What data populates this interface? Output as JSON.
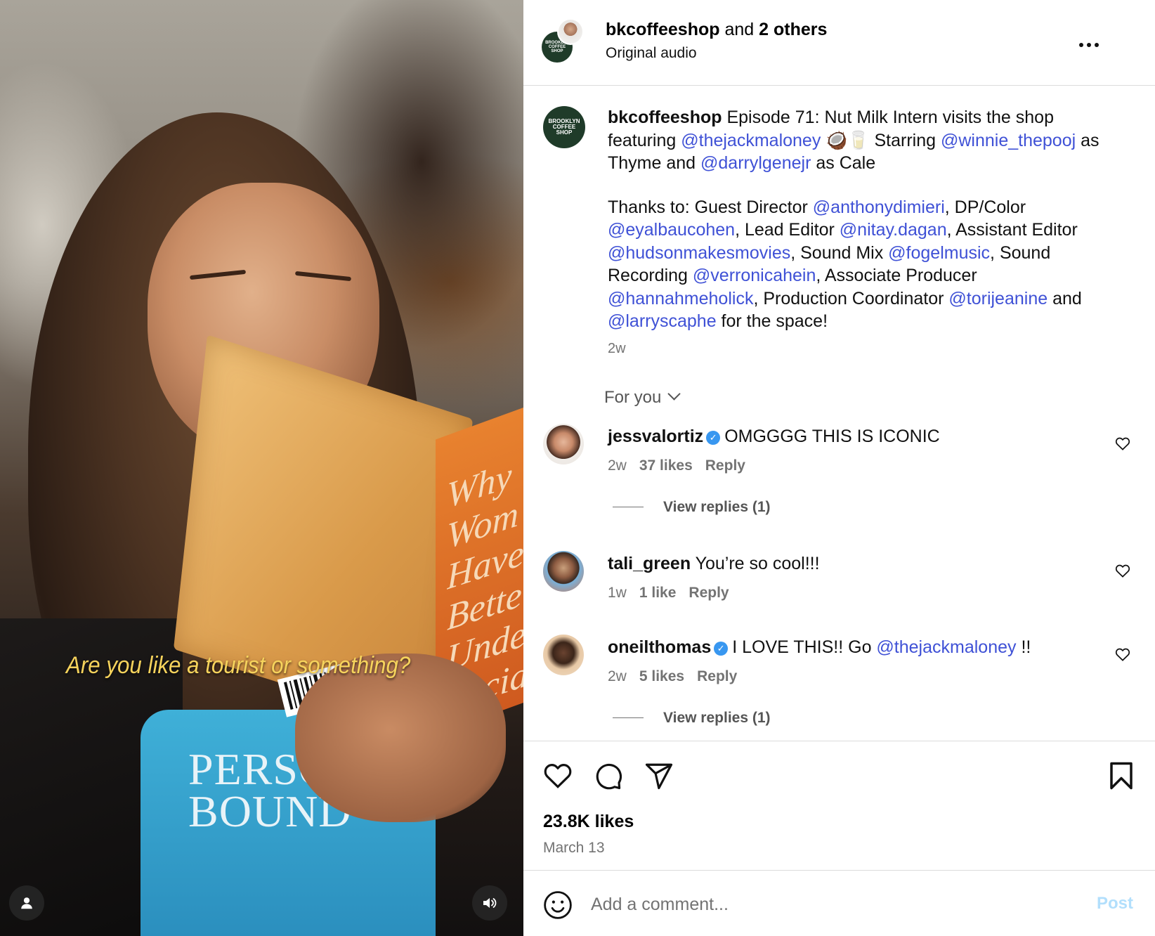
{
  "video": {
    "caption": "Are you like a tourist or something?",
    "shirt_text_line1": "PERSON",
    "shirt_text_line2": "BOUND",
    "book_title": "Why Wom Have Better Under Social"
  },
  "header": {
    "username": "bkcoffeeshop",
    "and_text": "and",
    "others": "2 others",
    "audio": "Original audio",
    "more": "..."
  },
  "brand": {
    "logo_l1": "BROOKLYN",
    "logo_l2": "COFFEE",
    "logo_l3": "SHOP"
  },
  "caption": {
    "username": "bkcoffeeshop",
    "t1": " Episode 71: Nut Milk Intern visits the shop featuring ",
    "m1": "@thejackmaloney",
    "emoji": " 🥥🥛 ",
    "t2": "Starring ",
    "m2": "@winnie_thepooj",
    "t3": " as Thyme and ",
    "m3": "@darrylgenejr",
    "t4": " as Cale",
    "t5": "Thanks to: Guest Director ",
    "m4": "@anthonydimieri",
    "t6": ", DP/Color ",
    "m5": "@eyalbaucohen",
    "t7": ", Lead Editor ",
    "m6": "@nitay.dagan",
    "t8": ", Assistant Editor ",
    "m7": "@hudsonmakesmovies",
    "t9": ", Sound Mix ",
    "m8": "@fogelmusic",
    "t10": ", Sound Recording ",
    "m9": "@verronicahein",
    "t11": ", Associate Producer ",
    "m10": "@hannahmeholick",
    "t12": ", Production Coordinator ",
    "m11": "@torijeanine",
    "t13": " and ",
    "m12": "@larryscaphe",
    "t14": " for the space!",
    "time": "2w"
  },
  "filter": {
    "label": "For you"
  },
  "comments": [
    {
      "username": "jessvalortiz",
      "verified": true,
      "text": "OMGGGG THIS IS ICONIC",
      "time": "2w",
      "likes": "37 likes",
      "reply": "Reply",
      "view_replies": "View replies (1)"
    },
    {
      "username": "tali_green",
      "verified": false,
      "text": "You’re so cool!!!",
      "time": "1w",
      "likes": "1 like",
      "reply": "Reply"
    },
    {
      "username": "oneilthomas",
      "verified": true,
      "text": "I LOVE THIS!! Go ",
      "mention": "@thejackmaloney",
      "text_after": " !!",
      "time": "2w",
      "likes": "5 likes",
      "reply": "Reply",
      "view_replies": "View replies (1)"
    }
  ],
  "stats": {
    "likes": "23.8K likes",
    "date": "March 13"
  },
  "composer": {
    "placeholder": "Add a comment...",
    "post": "Post"
  },
  "colors": {
    "link": "#3f51d6",
    "muted": "#737373",
    "post_disabled": "#b2dffc",
    "brand_green": "#1f3b29",
    "verified": "#3897f0"
  },
  "icons": [
    "user-icon",
    "volume-icon",
    "more-icon",
    "heart-icon",
    "comment-icon",
    "share-icon",
    "bookmark-icon",
    "emoji-icon",
    "chevron-down-icon",
    "verified-icon"
  ]
}
